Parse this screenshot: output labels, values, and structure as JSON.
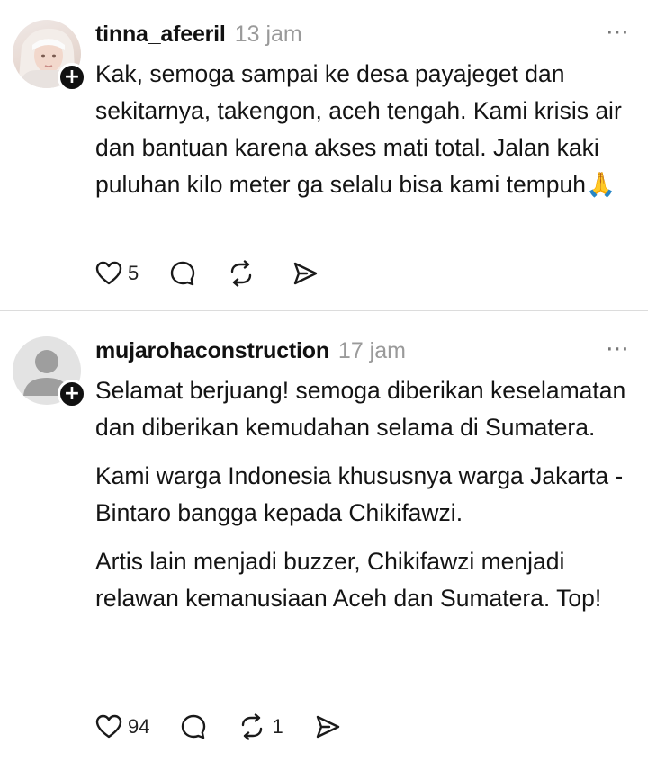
{
  "comments": [
    {
      "username": "tinna_afeeril",
      "time": "13 jam",
      "more_icon": "⋯",
      "text": [
        "Kak, semoga sampai ke desa payajeget dan sekitarnya, takengon, aceh tengah. Kami krisis air dan bantuan karena akses mati total. Jalan kaki puluhan kilo meter ga selalu bisa kami tempuh🙏"
      ],
      "likes": "5",
      "reposts": ""
    },
    {
      "username": "mujarohaconstruction",
      "time": "17 jam",
      "more_icon": "⋯",
      "text": [
        "Selamat berjuang! semoga diberikan keselamatan dan diberikan kemudahan selama di Sumatera.",
        "Kami warga Indonesia khususnya warga Jakarta - Bintaro bangga kepada  Chikifawzi.",
        "Artis lain menjadi buzzer, Chikifawzi menjadi relawan kemanusiaan Aceh dan Sumatera. Top!"
      ],
      "likes": "94",
      "reposts": "1"
    }
  ],
  "follow_badge": "+"
}
